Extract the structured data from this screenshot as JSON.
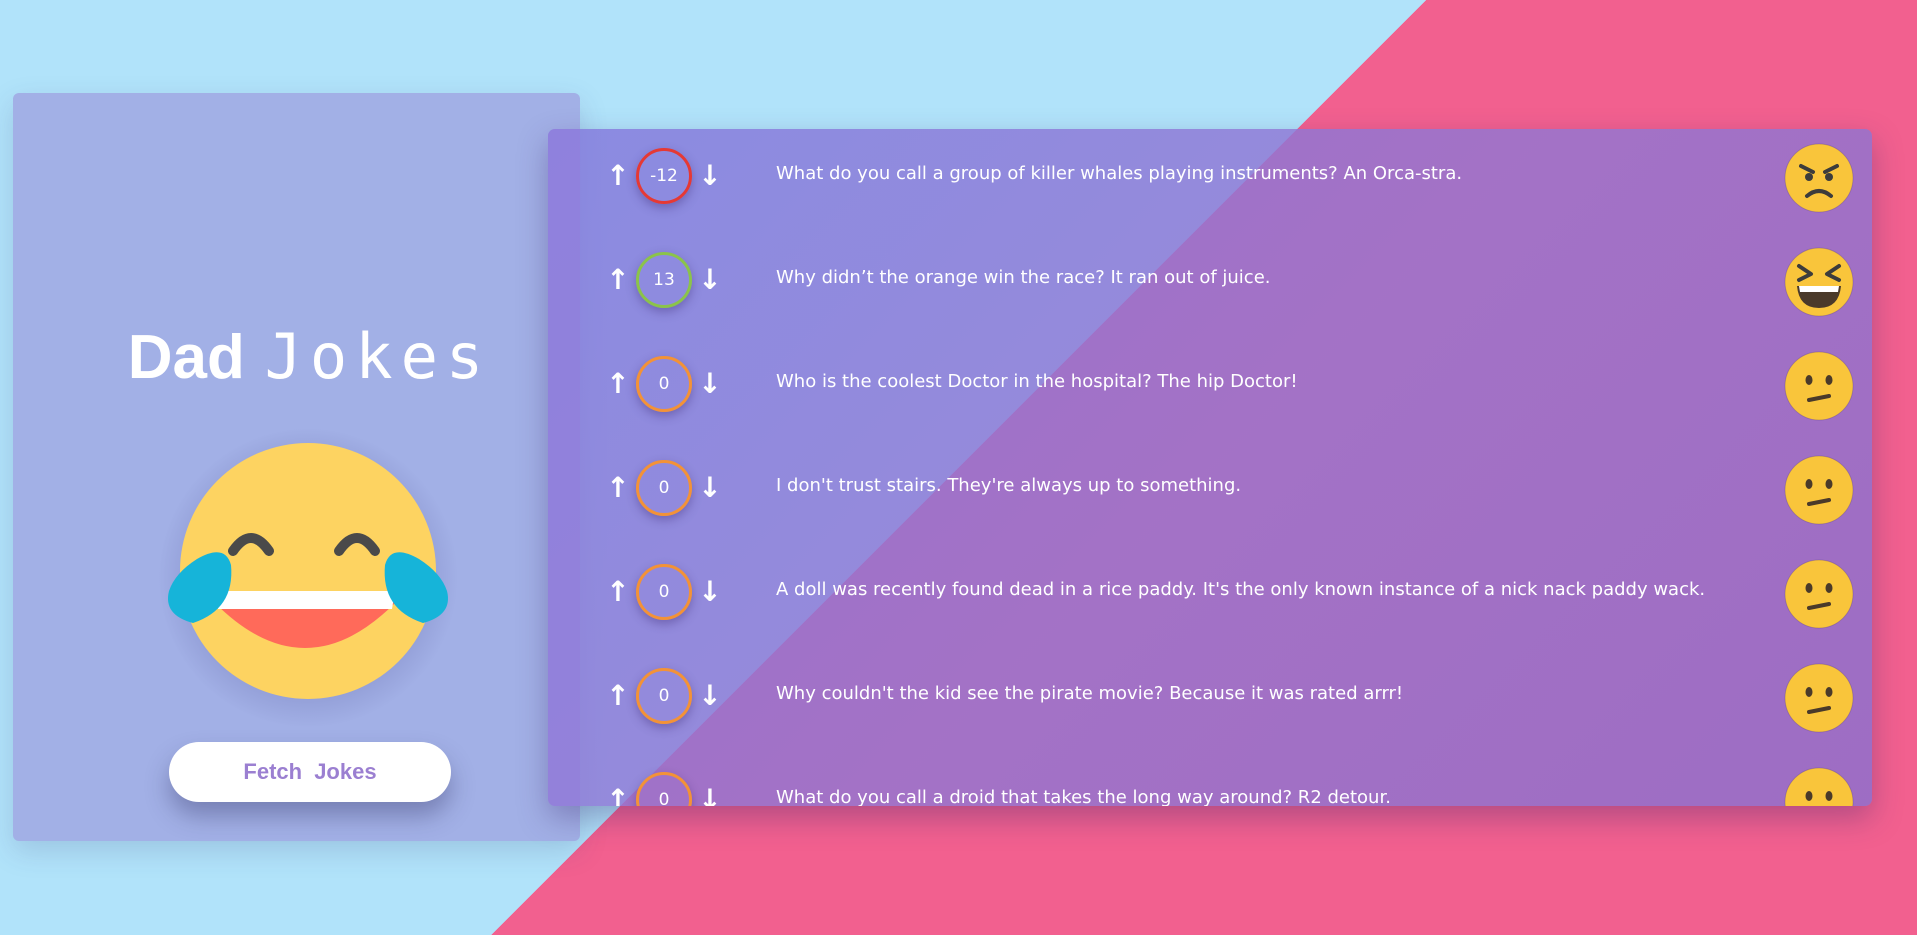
{
  "app": {
    "title_bold": "Dad",
    "title_light": "Jokes",
    "fetch_button": "Fetch Jokes",
    "hero_icon": "tears-of-joy-icon"
  },
  "colors": {
    "background_left": "#b1e3fa",
    "background_right": "#f2608f",
    "sidebar": "#a2b0e6",
    "panel": "#9682d6",
    "score_negative": "#e53935",
    "score_positive": "#8bc34a",
    "score_neutral": "#f39237",
    "button_text": "#9b7fd1"
  },
  "jokes": [
    {
      "score": "-12",
      "text": "What do you call a group of killer whales playing instruments? An Orca-stra.",
      "emoji": "angry-face-icon"
    },
    {
      "score": "13",
      "text": "Why didn’t the orange win the race? It ran out of juice.",
      "emoji": "grinning-squint-face-icon"
    },
    {
      "score": "0",
      "text": "Who is the coolest Doctor in the hospital? The hip Doctor!",
      "emoji": "confused-face-icon"
    },
    {
      "score": "0",
      "text": "I don't trust stairs. They're always up to something.",
      "emoji": "confused-face-icon"
    },
    {
      "score": "0",
      "text": "A doll was recently found dead in a rice paddy. It's the only known instance of a nick nack paddy wack.",
      "emoji": "confused-face-icon"
    },
    {
      "score": "0",
      "text": "Why couldn't the kid see the pirate movie? Because it was rated arrr!",
      "emoji": "confused-face-icon"
    },
    {
      "score": "0",
      "text": "What do you call a droid that takes the long way around? R2 detour.",
      "emoji": "confused-face-icon"
    }
  ],
  "icons": {
    "upvote": "↑",
    "downvote": "↓"
  }
}
